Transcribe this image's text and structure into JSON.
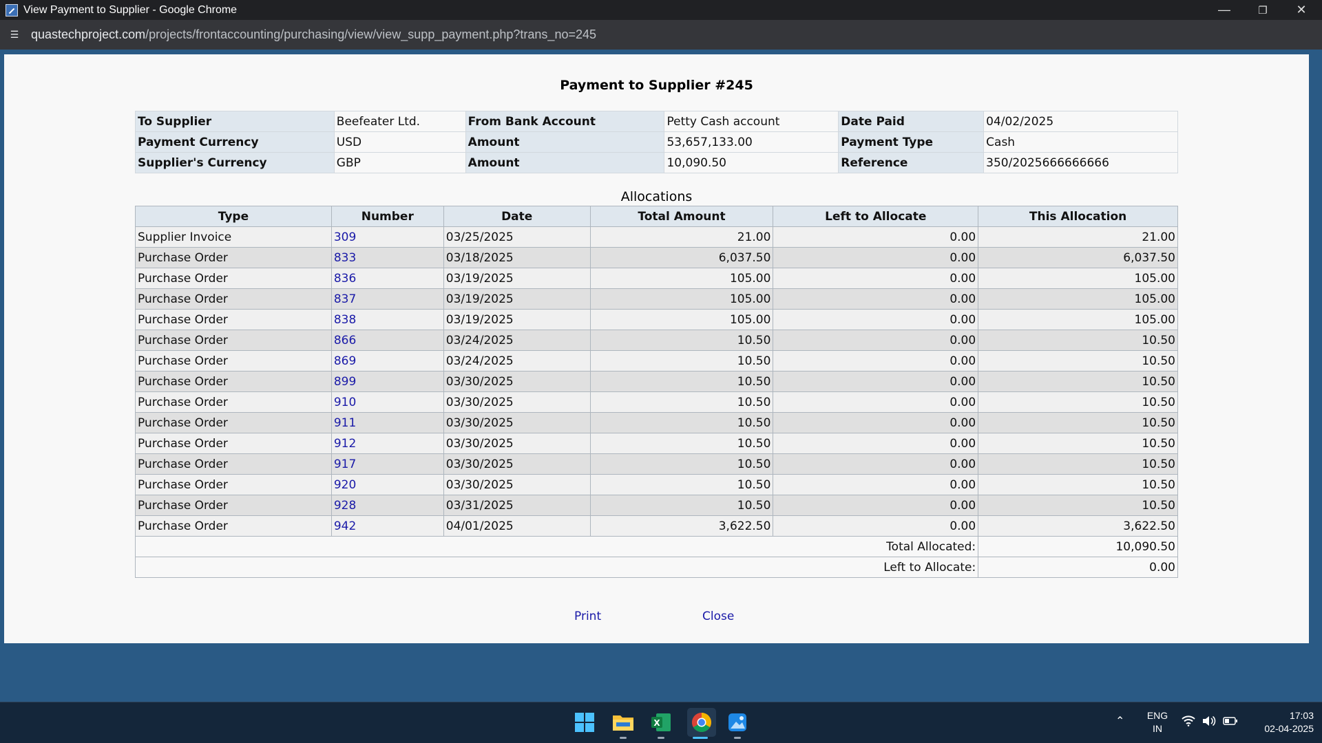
{
  "window": {
    "title": "View Payment to Supplier - Google Chrome",
    "url_host": "quastechproject.com",
    "url_path": "/projects/frontaccounting/purchasing/view/view_supp_payment.php?trans_no=245"
  },
  "page": {
    "title": "Payment to Supplier #245",
    "header": {
      "to_supplier_label": "To Supplier",
      "to_supplier_value": "Beefeater Ltd.",
      "from_bank_label": "From Bank Account",
      "from_bank_value": "Petty Cash account",
      "date_paid_label": "Date Paid",
      "date_paid_value": "04/02/2025",
      "payment_currency_label": "Payment Currency",
      "payment_currency_value": "USD",
      "amount_label": "Amount",
      "amount_value": "53,657,133.00",
      "payment_type_label": "Payment Type",
      "payment_type_value": "Cash",
      "supplier_currency_label": "Supplier's Currency",
      "supplier_currency_value": "GBP",
      "amount2_label": "Amount",
      "amount2_value": "10,090.50",
      "reference_label": "Reference",
      "reference_value": "350/2025666666666"
    },
    "allocations": {
      "caption": "Allocations",
      "columns": [
        "Type",
        "Number",
        "Date",
        "Total Amount",
        "Left to Allocate",
        "This Allocation"
      ],
      "rows": [
        [
          "Supplier Invoice",
          "309",
          "03/25/2025",
          "21.00",
          "0.00",
          "21.00"
        ],
        [
          "Purchase Order",
          "833",
          "03/18/2025",
          "6,037.50",
          "0.00",
          "6,037.50"
        ],
        [
          "Purchase Order",
          "836",
          "03/19/2025",
          "105.00",
          "0.00",
          "105.00"
        ],
        [
          "Purchase Order",
          "837",
          "03/19/2025",
          "105.00",
          "0.00",
          "105.00"
        ],
        [
          "Purchase Order",
          "838",
          "03/19/2025",
          "105.00",
          "0.00",
          "105.00"
        ],
        [
          "Purchase Order",
          "866",
          "03/24/2025",
          "10.50",
          "0.00",
          "10.50"
        ],
        [
          "Purchase Order",
          "869",
          "03/24/2025",
          "10.50",
          "0.00",
          "10.50"
        ],
        [
          "Purchase Order",
          "899",
          "03/30/2025",
          "10.50",
          "0.00",
          "10.50"
        ],
        [
          "Purchase Order",
          "910",
          "03/30/2025",
          "10.50",
          "0.00",
          "10.50"
        ],
        [
          "Purchase Order",
          "911",
          "03/30/2025",
          "10.50",
          "0.00",
          "10.50"
        ],
        [
          "Purchase Order",
          "912",
          "03/30/2025",
          "10.50",
          "0.00",
          "10.50"
        ],
        [
          "Purchase Order",
          "917",
          "03/30/2025",
          "10.50",
          "0.00",
          "10.50"
        ],
        [
          "Purchase Order",
          "920",
          "03/30/2025",
          "10.50",
          "0.00",
          "10.50"
        ],
        [
          "Purchase Order",
          "928",
          "03/31/2025",
          "10.50",
          "0.00",
          "10.50"
        ],
        [
          "Purchase Order",
          "942",
          "04/01/2025",
          "3,622.50",
          "0.00",
          "3,622.50"
        ]
      ],
      "total_allocated_label": "Total Allocated:",
      "total_allocated_value": "10,090.50",
      "left_to_allocate_label": "Left to Allocate:",
      "left_to_allocate_value": "0.00"
    },
    "print_label": "Print",
    "close_label": "Close"
  },
  "taskbar": {
    "icons": [
      "windows-start-icon",
      "file-explorer-icon",
      "excel-icon",
      "chrome-icon",
      "photos-icon"
    ],
    "lang_line1": "ENG",
    "lang_line2": "IN",
    "time": "17:03",
    "date": "02-04-2025"
  },
  "colors": {
    "desktop": "#2a5a85",
    "label_cell": "#dfe7ee",
    "link": "#1a1aa8",
    "taskbar": "#14263a"
  }
}
